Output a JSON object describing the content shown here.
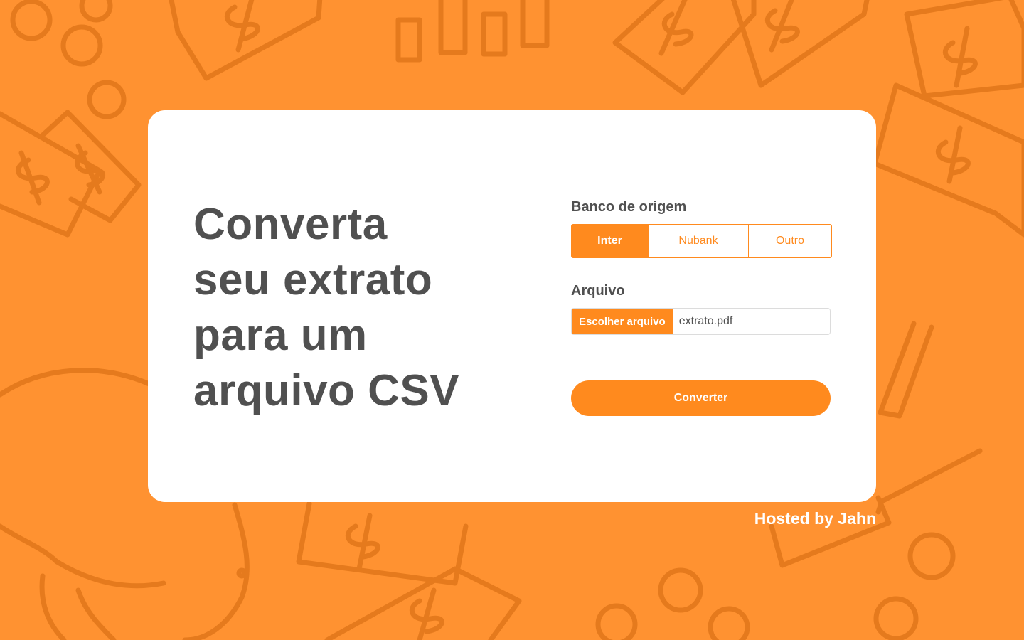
{
  "headline": {
    "line1": "Converta",
    "line2": "seu extrato",
    "line3": "para um",
    "line4": "arquivo CSV"
  },
  "form": {
    "bank_label": "Banco de origem",
    "bank_options": [
      "Inter",
      "Nubank",
      "Outro"
    ],
    "selected_bank": "Inter",
    "file_label": "Arquivo",
    "file_button": "Escolher arquivo",
    "file_name": "extrato.pdf",
    "submit_label": "Converter"
  },
  "footer": {
    "text": "Hosted by Jahn"
  },
  "colors": {
    "background": "#FF9231",
    "pattern": "#E57A1D",
    "accent": "#FF8A1E",
    "text": "#505050",
    "card": "#FFFFFF"
  },
  "icons": [
    "money-bill-doodle-icon",
    "coin-doodle-icon",
    "piggy-bank-doodle-icon"
  ]
}
